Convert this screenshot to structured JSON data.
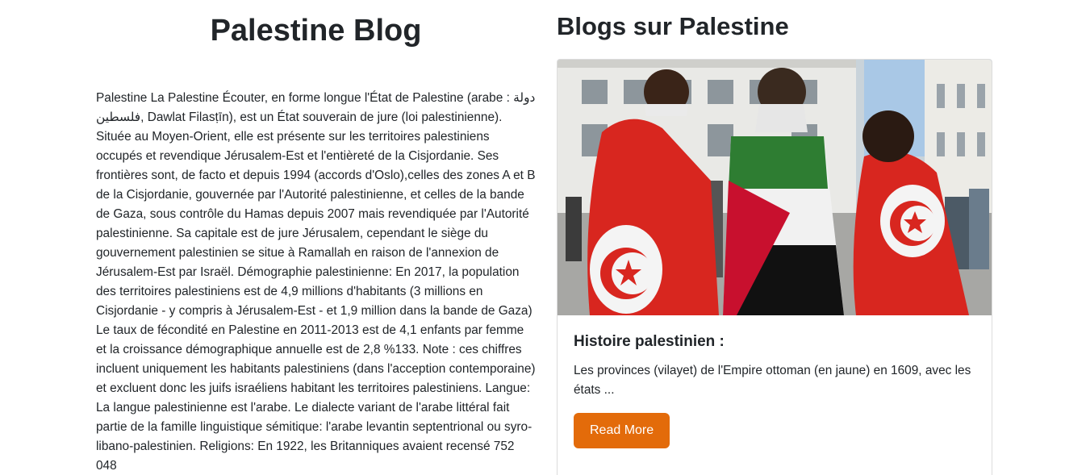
{
  "main": {
    "title": "Palestine Blog",
    "article": "Palestine La Palestine Écouter, en forme longue l'État de Palestine (arabe : دولة فلسطين, Dawlat Filasṭīn), est un État souverain de jure (loi palestinienne). Située au Moyen-Orient, elle est présente sur les territoires palestiniens occupés et revendique Jérusalem-Est et l'entièreté de la Cisjordanie. Ses frontières sont, de facto et depuis 1994 (accords d'Oslo),celles des zones A et B de la Cisjordanie, gouvernée par l'Autorité palestinienne, et celles de la bande de Gaza, sous contrôle du Hamas depuis 2007 mais revendiquée par l'Autorité palestinienne. Sa capitale est de jure Jérusalem, cependant le siège du gouvernement palestinien se situe à Ramallah en raison de l'annexion de Jérusalem-Est par Israël. Démographie palestinienne: En 2017, la population des territoires palestiniens est de 4,9 millions d'habitants (3 millions en Cisjordanie - y compris à Jérusalem-Est - et 1,9 million dans la bande de Gaza) Le taux de fécondité en Palestine en 2011-2013 est de 4,1 enfants par femme et la croissance démographique annuelle est de 2,8 %133. Note : ces chiffres incluent uniquement les habitants palestiniens (dans l'acception contemporaine) et excluent donc les juifs israéliens habitant les territoires palestiniens. Langue: La langue palestinienne est l'arabe. Le dialecte variant de l'arabe littéral fait partie de la famille linguistique sémitique: l'arabe levantin septentrional ou syro-libano-palestinien. Religions: En 1922, les Britanniques avaient recensé 752 048"
  },
  "sidebar": {
    "heading": "Blogs sur Palestine",
    "card": {
      "image_icon": "photo-people-with-flags",
      "title": "Histoire palestinien :",
      "excerpt": "Les provinces (vilayet) de l'Empire ottoman (en jaune) en 1609, avec les états ...",
      "button_label": "Read More"
    }
  },
  "colors": {
    "accent": "#e36b0a",
    "text": "#212529",
    "border": "#dcdcdc"
  }
}
